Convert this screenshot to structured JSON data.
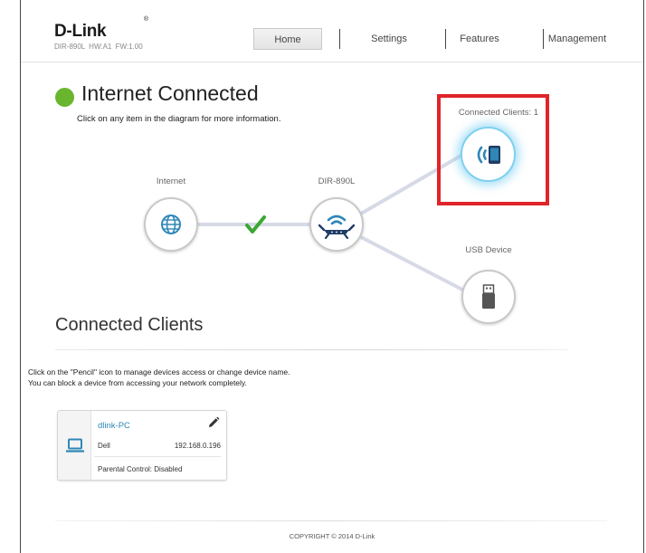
{
  "header": {
    "brand": "D-Link",
    "brand_mark": "®",
    "model_info": "DIR-890L  HW:A1  FW:1.00"
  },
  "nav": {
    "home": "Home",
    "settings": "Settings",
    "features": "Features",
    "management": "Management",
    "active": "Home"
  },
  "status": {
    "title": "Internet Connected",
    "subtitle": "Click on any item in the diagram for more information.",
    "color": "#6ab52e"
  },
  "diagram": {
    "internet_label": "Internet",
    "router_label": "DIR-890L",
    "clients_label": "Connected Clients: 1",
    "usb_label": "USB Device",
    "link_ok_color": "#3aa832",
    "accent_color": "#2f87b8",
    "highlight_color": "#e0242a"
  },
  "connected_clients": {
    "title": "Connected Clients",
    "help_line1": "Click on the \"Pencil\" icon to manage devices access or change device name.",
    "help_line2": "You can block a device from accessing your network completely.",
    "clients": [
      {
        "name": "dlink-PC",
        "vendor": "Dell",
        "ip": "192.168.0.196",
        "parental_label": "Parental Control:",
        "parental_value": "Disabled"
      }
    ]
  },
  "footer": {
    "copyright": "COPYRIGHT © 2014 D-Link"
  }
}
